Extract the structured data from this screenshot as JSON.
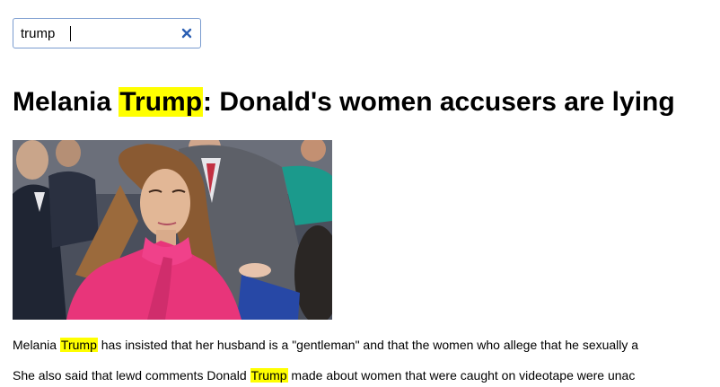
{
  "search": {
    "value": "trump"
  },
  "article": {
    "headline": {
      "before": "Melania ",
      "highlight": "Trump",
      "after": ": Donald's women accusers are lying"
    },
    "photo_alt": "",
    "paragraphs": [
      {
        "before": "Melania ",
        "highlight": "Trump",
        "after": " has insisted that her husband is a \"gentleman\" and that the women who allege that he sexually a"
      },
      {
        "before": "She also said that lewd comments Donald ",
        "highlight": "Trump",
        "after": " made about women that were caught on videotape were unac"
      }
    ]
  },
  "colors": {
    "highlight": "#ffff00",
    "search_border": "#7a9ccf",
    "clear_icon": "#2b5fb3"
  },
  "icons": {
    "clear": "close-icon"
  }
}
